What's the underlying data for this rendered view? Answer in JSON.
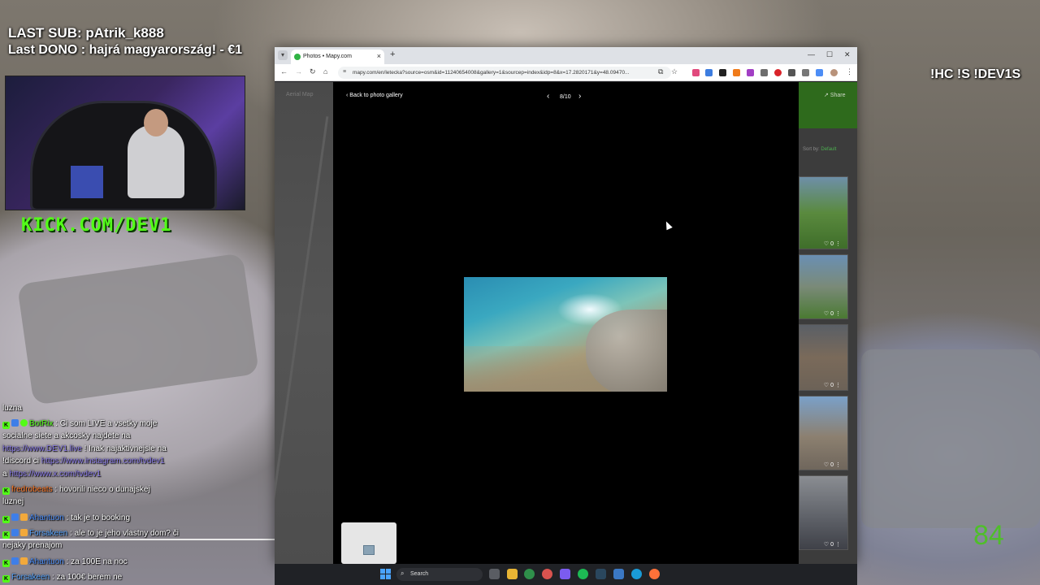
{
  "overlay": {
    "last_sub": "LAST SUB: pAtrik_k888",
    "last_dono": "Last DONO : hajrá magyarország! - €1",
    "commands": "!HC !S !DEV1S",
    "kick_url": "KICK.COM/DEV1",
    "counter": "84"
  },
  "chat": {
    "messages": [
      {
        "text": "luzna"
      },
      {
        "user": "BotRix",
        "pre": "Ci som LIVE a vsetky moje",
        "line2": "socialne siete a akcosky najdete na",
        "link1": "https://www.DEV1.live",
        "after_link1": "! Inak najaktivnejsie na",
        "pre2": "!discord ci",
        "link2": "https://www.instagram.com/tvdev1",
        "pre3": "a",
        "link3": "https://www.x.com/tvdev1"
      },
      {
        "user": "fredrobeats",
        "text": "hovorili nieco o dunajskej",
        "line2": "luznej"
      },
      {
        "user": "Ahantuon",
        "text": "tak je to booking"
      },
      {
        "user": "Forsakeen",
        "text": "ale to je jeho vlastny dom? či",
        "line2": "nejaky prenajom"
      },
      {
        "user": "Ahantuon",
        "text": "za 100E na noc"
      },
      {
        "user": "Forsakeen",
        "text": "za 100€ berem ne"
      }
    ]
  },
  "browser": {
    "tab_title": "Photos • Mapy.com",
    "url": "mapy.com/en/letecka?source=osm&id=11240654008&gallery=1&sourcep=index&idp=8&x=17.2820171&y=48.09470...",
    "map_label": "Aerial Map",
    "share_label": "Share",
    "sort_label": "Sort by:",
    "sort_value": "Default",
    "thumb_likes": [
      "0",
      "0",
      "0",
      "0",
      "0"
    ]
  },
  "viewer": {
    "back_label": "Back to photo gallery",
    "pager": "8/10"
  },
  "taskbar": {
    "search_label": "Search"
  },
  "colors": {
    "kick_green": "#53fc18",
    "counter_green": "#4fbe2a",
    "photo_water": "#2a8db2"
  }
}
